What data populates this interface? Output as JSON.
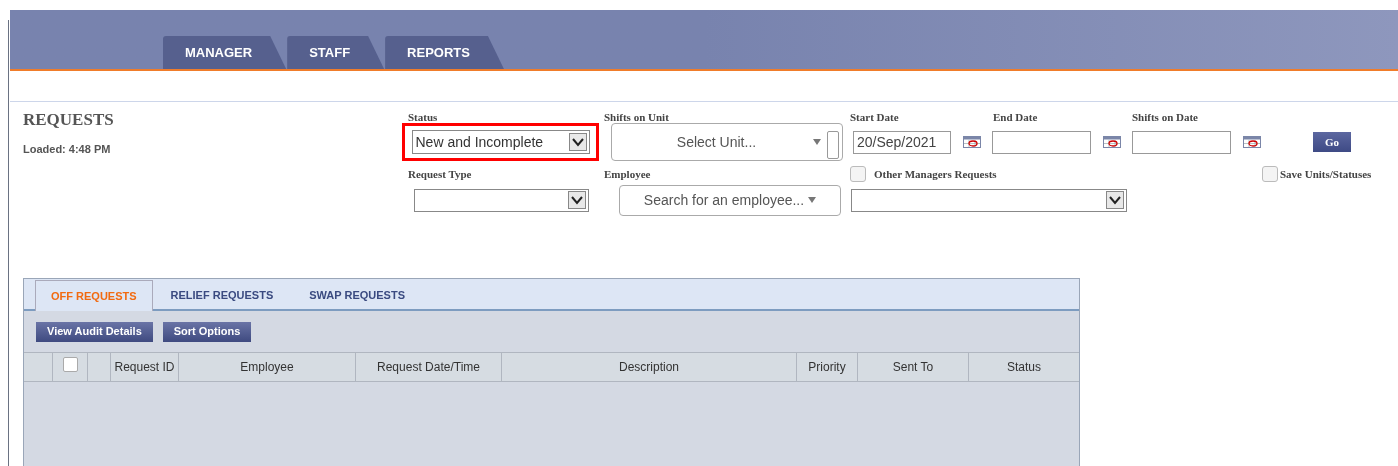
{
  "nav_tabs": [
    {
      "label": "MANAGER",
      "selected": false
    },
    {
      "label": "STAFF",
      "selected": false
    },
    {
      "label": "REPORTS",
      "selected": false
    }
  ],
  "page": {
    "title": "REQUESTS",
    "loaded": "Loaded: 4:48 PM"
  },
  "filters": {
    "status": {
      "label": "Status",
      "value": "New and Incomplete",
      "highlighted": true
    },
    "shifts_on_unit": {
      "label": "Shifts on Unit",
      "placeholder": "Select Unit..."
    },
    "start_date": {
      "label": "Start Date",
      "value": "20/Sep/2021"
    },
    "end_date": {
      "label": "End Date"
    },
    "shifts_on_date": {
      "label": "Shifts on Date"
    },
    "go_button": "Go",
    "request_type": {
      "label": "Request Type"
    },
    "employee": {
      "label": "Employee",
      "placeholder": "Search for an employee..."
    },
    "other_managers": {
      "label": "Other Managers Requests",
      "checked": false
    },
    "save_units": {
      "label": "Save Units/Statuses",
      "checked": false
    }
  },
  "request_tabs": [
    {
      "label": "OFF REQUESTS",
      "selected": true
    },
    {
      "label": "RELIEF REQUESTS",
      "selected": false
    },
    {
      "label": "SWAP REQUESTS",
      "selected": false
    }
  ],
  "toolbar": [
    "View Audit Details",
    "Sort Options"
  ],
  "table": {
    "select_all": false,
    "columns": [
      "Request ID",
      "Employee",
      "Request Date/Time",
      "Description",
      "Priority",
      "Sent To",
      "Status"
    ]
  }
}
